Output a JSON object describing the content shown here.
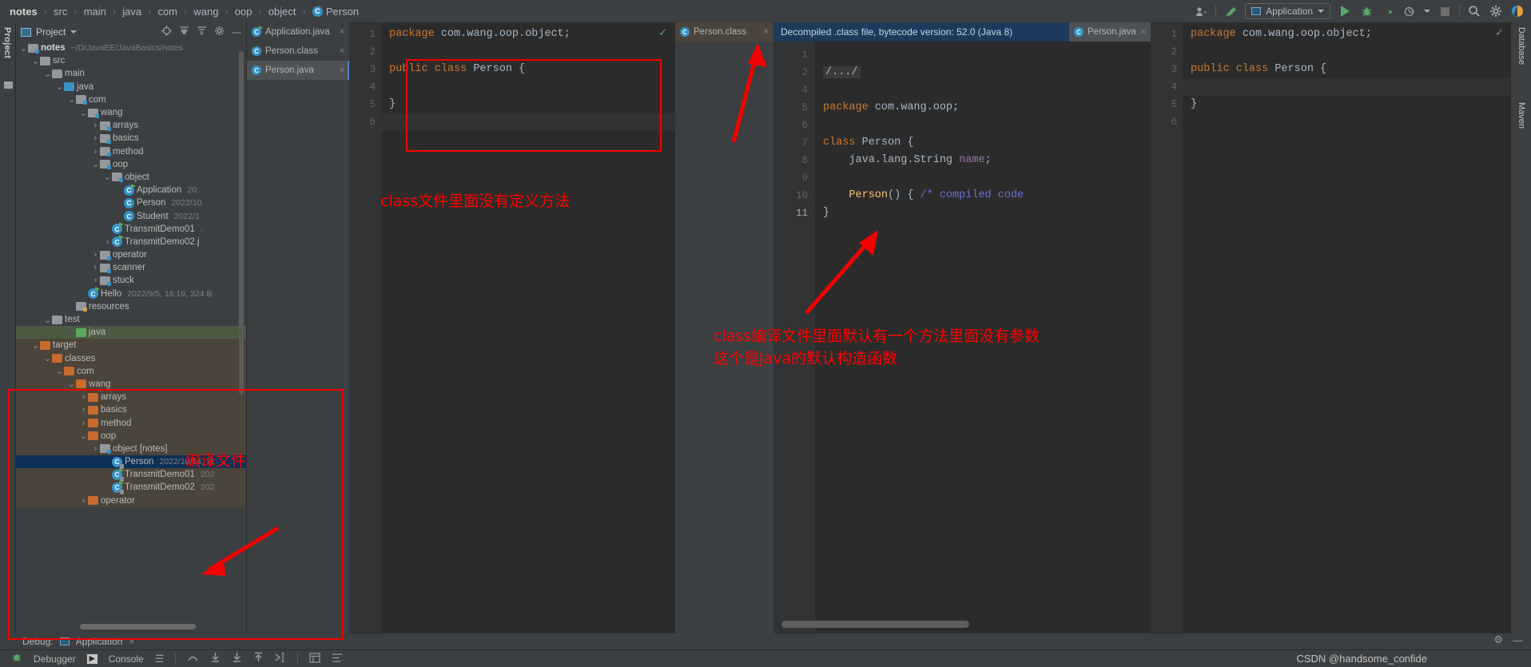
{
  "breadcrumb": {
    "items": [
      "notes",
      "src",
      "main",
      "java",
      "com",
      "wang",
      "oop",
      "object"
    ],
    "last": "Person",
    "last_icon": "C"
  },
  "toolbar": {
    "account_icon": "account-icon",
    "hammer_icon": "build-icon",
    "run_config": "Application",
    "run_label": "Run",
    "debug_label": "Debug",
    "coverage_label": "Run with Coverage",
    "profiler_label": "Profiler",
    "stop_label": "Stop",
    "search_icon": "⌕",
    "settings_icon": "⚙",
    "updates_icon": "updates-icon"
  },
  "left_strip": {
    "project_tab": "Project"
  },
  "project_panel": {
    "title": "Project",
    "icons": [
      "locate-icon",
      "collapse-all-icon",
      "expand-icon",
      "gear-icon",
      "hide-icon"
    ],
    "tree": [
      {
        "indent": 0,
        "arrow": "v",
        "icon": "folder-src",
        "name": "notes",
        "bold": true,
        "meta": "~/D/JavaEE/JavaBasics/notes"
      },
      {
        "indent": 1,
        "arrow": "v",
        "icon": "folder-gray",
        "name": "src",
        "meta": ""
      },
      {
        "indent": 2,
        "arrow": "v",
        "icon": "folder-gray",
        "name": "main",
        "meta": ""
      },
      {
        "indent": 3,
        "arrow": "v",
        "icon": "folder-blue",
        "name": "java",
        "meta": ""
      },
      {
        "indent": 4,
        "arrow": "v",
        "icon": "folder-pkg",
        "name": "com",
        "meta": ""
      },
      {
        "indent": 5,
        "arrow": "v",
        "icon": "folder-pkg",
        "name": "wang",
        "meta": ""
      },
      {
        "indent": 6,
        "arrow": ">",
        "icon": "folder-pkg",
        "name": "arrays",
        "meta": ""
      },
      {
        "indent": 6,
        "arrow": ">",
        "icon": "folder-pkg",
        "name": "basics",
        "meta": ""
      },
      {
        "indent": 6,
        "arrow": ">",
        "icon": "folder-pkg",
        "name": "method",
        "meta": ""
      },
      {
        "indent": 6,
        "arrow": "v",
        "icon": "folder-pkg",
        "name": "oop",
        "meta": ""
      },
      {
        "indent": 7,
        "arrow": "v",
        "icon": "folder-pkg",
        "name": "object",
        "meta": ""
      },
      {
        "indent": 8,
        "arrow": "",
        "icon": "class-run",
        "name": "Application",
        "meta": "20:"
      },
      {
        "indent": 8,
        "arrow": "",
        "icon": "class",
        "name": "Person",
        "meta": "2022/10"
      },
      {
        "indent": 8,
        "arrow": "",
        "icon": "class",
        "name": "Student",
        "meta": "2022/1"
      },
      {
        "indent": 7,
        "arrow": "",
        "icon": "class-run",
        "name": "TransmitDemo01",
        "meta": ":"
      },
      {
        "indent": 7,
        "arrow": ">",
        "icon": "class-run",
        "name": "TransmitDemo02.j",
        "meta": ""
      },
      {
        "indent": 6,
        "arrow": ">",
        "icon": "folder-pkg",
        "name": "operator",
        "meta": ""
      },
      {
        "indent": 6,
        "arrow": ">",
        "icon": "folder-pkg",
        "name": "scanner",
        "meta": ""
      },
      {
        "indent": 6,
        "arrow": ">",
        "icon": "folder-pkg",
        "name": "stuck",
        "meta": ""
      },
      {
        "indent": 5,
        "arrow": "",
        "icon": "class-run",
        "name": "Hello",
        "meta": "2022/9/5, 16:19, 324 B"
      },
      {
        "indent": 4,
        "arrow": "",
        "icon": "folder-res",
        "name": "resources",
        "meta": ""
      },
      {
        "indent": 2,
        "arrow": "v",
        "icon": "folder-gray",
        "name": "test",
        "meta": ""
      },
      {
        "indent": 4,
        "arrow": "",
        "icon": "folder-green",
        "name": "java",
        "meta": "",
        "selected": "green"
      },
      {
        "indent": 1,
        "arrow": "v",
        "icon": "folder-orange",
        "name": "target",
        "meta": "",
        "target": true
      },
      {
        "indent": 2,
        "arrow": "v",
        "icon": "folder-orange",
        "name": "classes",
        "meta": "",
        "target": true
      },
      {
        "indent": 3,
        "arrow": "v",
        "icon": "folder-orange",
        "name": "com",
        "meta": "",
        "target": true
      },
      {
        "indent": 4,
        "arrow": "v",
        "icon": "folder-orange",
        "name": "wang",
        "meta": "",
        "target": true
      },
      {
        "indent": 5,
        "arrow": ">",
        "icon": "folder-orange",
        "name": "arrays",
        "meta": "",
        "target": true
      },
      {
        "indent": 5,
        "arrow": ">",
        "icon": "folder-orange",
        "name": "basics",
        "meta": "",
        "target": true
      },
      {
        "indent": 5,
        "arrow": ">",
        "icon": "folder-orange",
        "name": "method",
        "meta": "",
        "target": true
      },
      {
        "indent": 5,
        "arrow": "v",
        "icon": "folder-orange",
        "name": "oop",
        "meta": "",
        "target": true
      },
      {
        "indent": 6,
        "arrow": ">",
        "icon": "folder-src",
        "name": "object [notes]",
        "meta": "",
        "target": true
      },
      {
        "indent": 7,
        "arrow": "",
        "icon": "class-lock",
        "name": "Person",
        "meta": "2022/10/14, 11:",
        "selected": "blue"
      },
      {
        "indent": 7,
        "arrow": "",
        "icon": "class-runlock",
        "name": "TransmitDemo01",
        "meta": "202",
        "target": true
      },
      {
        "indent": 7,
        "arrow": "",
        "icon": "class-runlock",
        "name": "TransmitDemo02",
        "meta": "202",
        "target": true
      },
      {
        "indent": 5,
        "arrow": ">",
        "icon": "folder-orange",
        "name": "operator",
        "meta": "",
        "target": true
      }
    ]
  },
  "editor1": {
    "tabs": [
      {
        "label": "Application.java",
        "icon": "class-run",
        "active": false
      },
      {
        "label": "Person.class",
        "icon": "class",
        "active": false
      },
      {
        "label": "Person.java",
        "icon": "class",
        "active": true
      }
    ],
    "line_numbers": [
      "1",
      "2",
      "3",
      "4",
      "5",
      "6"
    ],
    "lines": [
      [
        {
          "t": "package",
          "c": "kw"
        },
        {
          "t": " com.wang.oop.object;",
          "c": "pl"
        }
      ],
      [],
      [
        {
          "t": "public class",
          "c": "kw"
        },
        {
          "t": " Person {",
          "c": "pl"
        }
      ],
      [],
      [
        {
          "t": "}",
          "c": "pl"
        }
      ],
      []
    ],
    "inspection_ok": "✓"
  },
  "editor2": {
    "tab": {
      "label": "Person.class",
      "icon": "class"
    },
    "banner": "Decompiled .class file, bytecode version: 52.0 (Java 8)",
    "line_numbers": [
      "1",
      "2",
      "4",
      "5",
      "6",
      "7",
      "8",
      "9",
      "10",
      "11"
    ],
    "folded_marker": "/.../",
    "lines": [
      [],
      [
        {
          "t": "FOLD",
          "c": "folded"
        }
      ],
      [],
      [
        {
          "t": "package",
          "c": "kw"
        },
        {
          "t": " com.wang.oop;",
          "c": "pl"
        }
      ],
      [],
      [
        {
          "t": "class",
          "c": "kw"
        },
        {
          "t": " Person {",
          "c": "pl"
        }
      ],
      [
        {
          "t": "    java.lang.String ",
          "c": "pl"
        },
        {
          "t": "name",
          "c": "fld"
        },
        {
          "t": ";",
          "c": "pl"
        }
      ],
      [],
      [
        {
          "t": "    ",
          "c": "pl"
        },
        {
          "t": "Person",
          "c": "mth"
        },
        {
          "t": "() { ",
          "c": "pl"
        },
        {
          "t": "/* compiled code",
          "c": "cm"
        }
      ],
      [
        {
          "t": "}",
          "c": "pl"
        }
      ]
    ]
  },
  "editor3": {
    "tab": {
      "label": "Person.java",
      "icon": "class"
    },
    "line_numbers": [
      "1",
      "2",
      "3",
      "4",
      "5",
      "6"
    ],
    "lines": [
      [
        {
          "t": "package",
          "c": "kw"
        },
        {
          "t": " com.wang.oop.object;",
          "c": "pl"
        }
      ],
      [],
      [
        {
          "t": "public class",
          "c": "kw"
        },
        {
          "t": " Person {",
          "c": "pl"
        }
      ],
      [],
      [
        {
          "t": "}",
          "c": "pl"
        }
      ],
      []
    ],
    "inspection_ok": "✓"
  },
  "right_strip": {
    "tabs": [
      "Database",
      "Maven"
    ]
  },
  "debug_row": {
    "label": "Debug:",
    "config": "Application",
    "close": "×"
  },
  "bottom_bar": {
    "debugger_tab": "Debugger",
    "console_tab": "Console",
    "console_icon": "▶",
    "icons": [
      "menu-icon",
      "step-over-icon",
      "step-into-icon",
      "force-step-into-icon",
      "step-out-icon",
      "run-to-cursor-icon",
      "evaluate-icon",
      "layout-icon"
    ],
    "settings_icon": "⚙",
    "hide_icon": "—"
  },
  "annotations": {
    "note1": "class文件里面没有定义方法",
    "note2_line1": "class编译文件里面默认有一个方法里面没有参数",
    "note2_line2": "这个是Java的默认构造函数",
    "note3": "编译文件"
  },
  "watermark": "CSDN @handsome_confide",
  "colors": {
    "accent_blue": "#3592c4",
    "banner_blue": "#1d3a5c",
    "annotation_red": "#ff0000",
    "green_run": "#59a869",
    "folder_orange": "#c96b2e",
    "selection_blue": "#0d3055",
    "selection_green": "#4b5a43"
  }
}
